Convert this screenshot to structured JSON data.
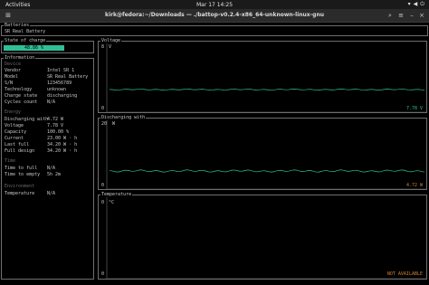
{
  "topbar": {
    "activities": "Activities",
    "clock": "Mar 17  14:25",
    "tray": [
      "net-icon",
      "volume-icon",
      "power-icon"
    ]
  },
  "window": {
    "title": "kirk@fedora:~/Downloads — ./battop-v0.2.4-x86_64-unknown-linux-gnu"
  },
  "batteries": {
    "label": "Batteries",
    "tab": "SR Real Battery"
  },
  "soc": {
    "label": "State of charge",
    "value": "48.86 %",
    "fraction": 0.4886
  },
  "info": {
    "label": "Information",
    "device_title": "Device",
    "device": [
      {
        "k": "Vendor",
        "v": "Intel SR 1"
      },
      {
        "k": "Model",
        "v": "SR Real Battery"
      },
      {
        "k": "S/N",
        "v": "123456789"
      },
      {
        "k": "Technology",
        "v": "unknown"
      },
      {
        "k": "Charge state",
        "v": "discharging"
      },
      {
        "k": "Cycles count",
        "v": "N/A"
      }
    ],
    "energy_title": "Energy",
    "energy": [
      {
        "k": "Discharging with",
        "v": "4.72 W"
      },
      {
        "k": "Voltage",
        "v": "7.78 V"
      },
      {
        "k": "Capacity",
        "v": "100.00 %"
      },
      {
        "k": "Current",
        "v": "23.00 W · h"
      },
      {
        "k": "Last full",
        "v": "34.20 W · h"
      },
      {
        "k": "Full design",
        "v": "34.20 W · h"
      }
    ],
    "time_title": "Time",
    "time": [
      {
        "k": "Time to full",
        "v": "N/A"
      },
      {
        "k": "Time to empty",
        "v": "5h 2m"
      }
    ],
    "env_title": "Environment",
    "env": [
      {
        "k": "Temperature",
        "v": "N/A"
      }
    ]
  },
  "graphs": [
    {
      "label": "Voltage",
      "unit": "V",
      "ymin": "0",
      "ymax": "8",
      "current": "7.78 V",
      "current_color": "#2fbf98"
    },
    {
      "label": "Discharging with",
      "unit": "W",
      "ymin": "0",
      "ymax": "20",
      "current": "4.72 W",
      "current_color": "#d2802c"
    },
    {
      "label": "Temperature",
      "unit": "°C",
      "ymin": "0",
      "ymax": "0",
      "current": "NOT AVAILABLE",
      "current_color": "#d2802c"
    }
  ],
  "colors": {
    "accent": "#2fbf98",
    "warn": "#d2802c",
    "border": "#6f6f6f"
  }
}
